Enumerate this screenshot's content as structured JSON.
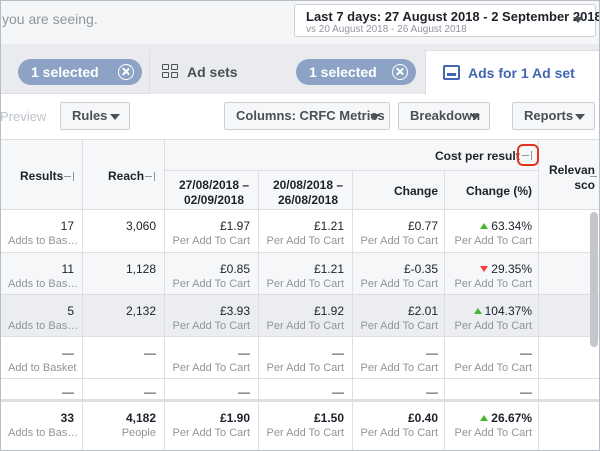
{
  "header": {
    "seeing_text": "you are seeing.",
    "date_main": "Last 7 days: 27 August 2018 - 2 September 2018",
    "date_compare": "vs 20 August 2018 - 26 August 2018"
  },
  "tabs": {
    "campaigns_selected": "1 selected",
    "adsets_label": "Ad sets",
    "adsets_selected": "1 selected",
    "ads_label": "Ads for 1 Ad set"
  },
  "toolbar": {
    "preview": "Preview",
    "rules": "Rules",
    "columns": "Columns: CRFC Metrics",
    "breakdown": "Breakdown",
    "reports": "Reports"
  },
  "table": {
    "headers": {
      "results": "Results",
      "reach": "Reach",
      "cost_group": "Cost per result",
      "period1": "27/08/2018 –\n02/09/2018",
      "period2": "20/08/2018 –\n26/08/2018",
      "change": "Change",
      "change_pct": "Change (%)",
      "relevance": "Relevan\nsco"
    },
    "rows": [
      {
        "results": "17",
        "results_sub": "Adds to Bas…",
        "reach": "3,060",
        "p1": "£1.97",
        "p1_sub": "Per Add To Cart",
        "p2": "£1.21",
        "p2_sub": "Per Add To Cart",
        "chg": "£0.77",
        "chg_sub": "Per Add To Cart",
        "pct": "63.34%",
        "pct_sub": "Per Add To Cart",
        "dir": "up"
      },
      {
        "results": "11",
        "results_sub": "Adds to Bas…",
        "reach": "1,128",
        "p1": "£0.85",
        "p1_sub": "Per Add To Cart",
        "p2": "£1.21",
        "p2_sub": "Per Add To Cart",
        "chg": "£-0.35",
        "chg_sub": "Per Add To Cart",
        "pct": "29.35%",
        "pct_sub": "Per Add To Cart",
        "dir": "down"
      },
      {
        "results": "5",
        "results_sub": "Adds to Bas…",
        "reach": "2,132",
        "p1": "£3.93",
        "p1_sub": "Per Add To Cart",
        "p2": "£1.92",
        "p2_sub": "Per Add To Cart",
        "chg": "£2.01",
        "chg_sub": "Per Add To Cart",
        "pct": "104.37%",
        "pct_sub": "Per Add To Cart",
        "dir": "up"
      },
      {
        "results": "—",
        "results_sub": "Add to Basket",
        "reach": "—",
        "p1": "—",
        "p1_sub": "Per Add To Cart",
        "p2": "—",
        "p2_sub": "Per Add To Cart",
        "chg": "—",
        "chg_sub": "Per Add To Cart",
        "pct": "—",
        "pct_sub": "Per Add To Cart",
        "dir": "none"
      },
      {
        "results": "—",
        "results_sub": "",
        "reach": "—",
        "p1": "—",
        "p1_sub": "",
        "p2": "—",
        "p2_sub": "",
        "chg": "—",
        "chg_sub": "",
        "pct": "—",
        "pct_sub": "",
        "dir": "none"
      }
    ],
    "totals": {
      "results": "33",
      "results_sub": "Adds to Bas…",
      "reach": "4,182",
      "reach_sub": "People",
      "p1": "£1.90",
      "p1_sub": "Per Add To Cart",
      "p2": "£1.50",
      "p2_sub": "Per Add To Cart",
      "chg": "£0.40",
      "chg_sub": "Per Add To Cart",
      "pct": "26.67%",
      "pct_sub": "Per Add To Cart",
      "dir": "up"
    }
  }
}
